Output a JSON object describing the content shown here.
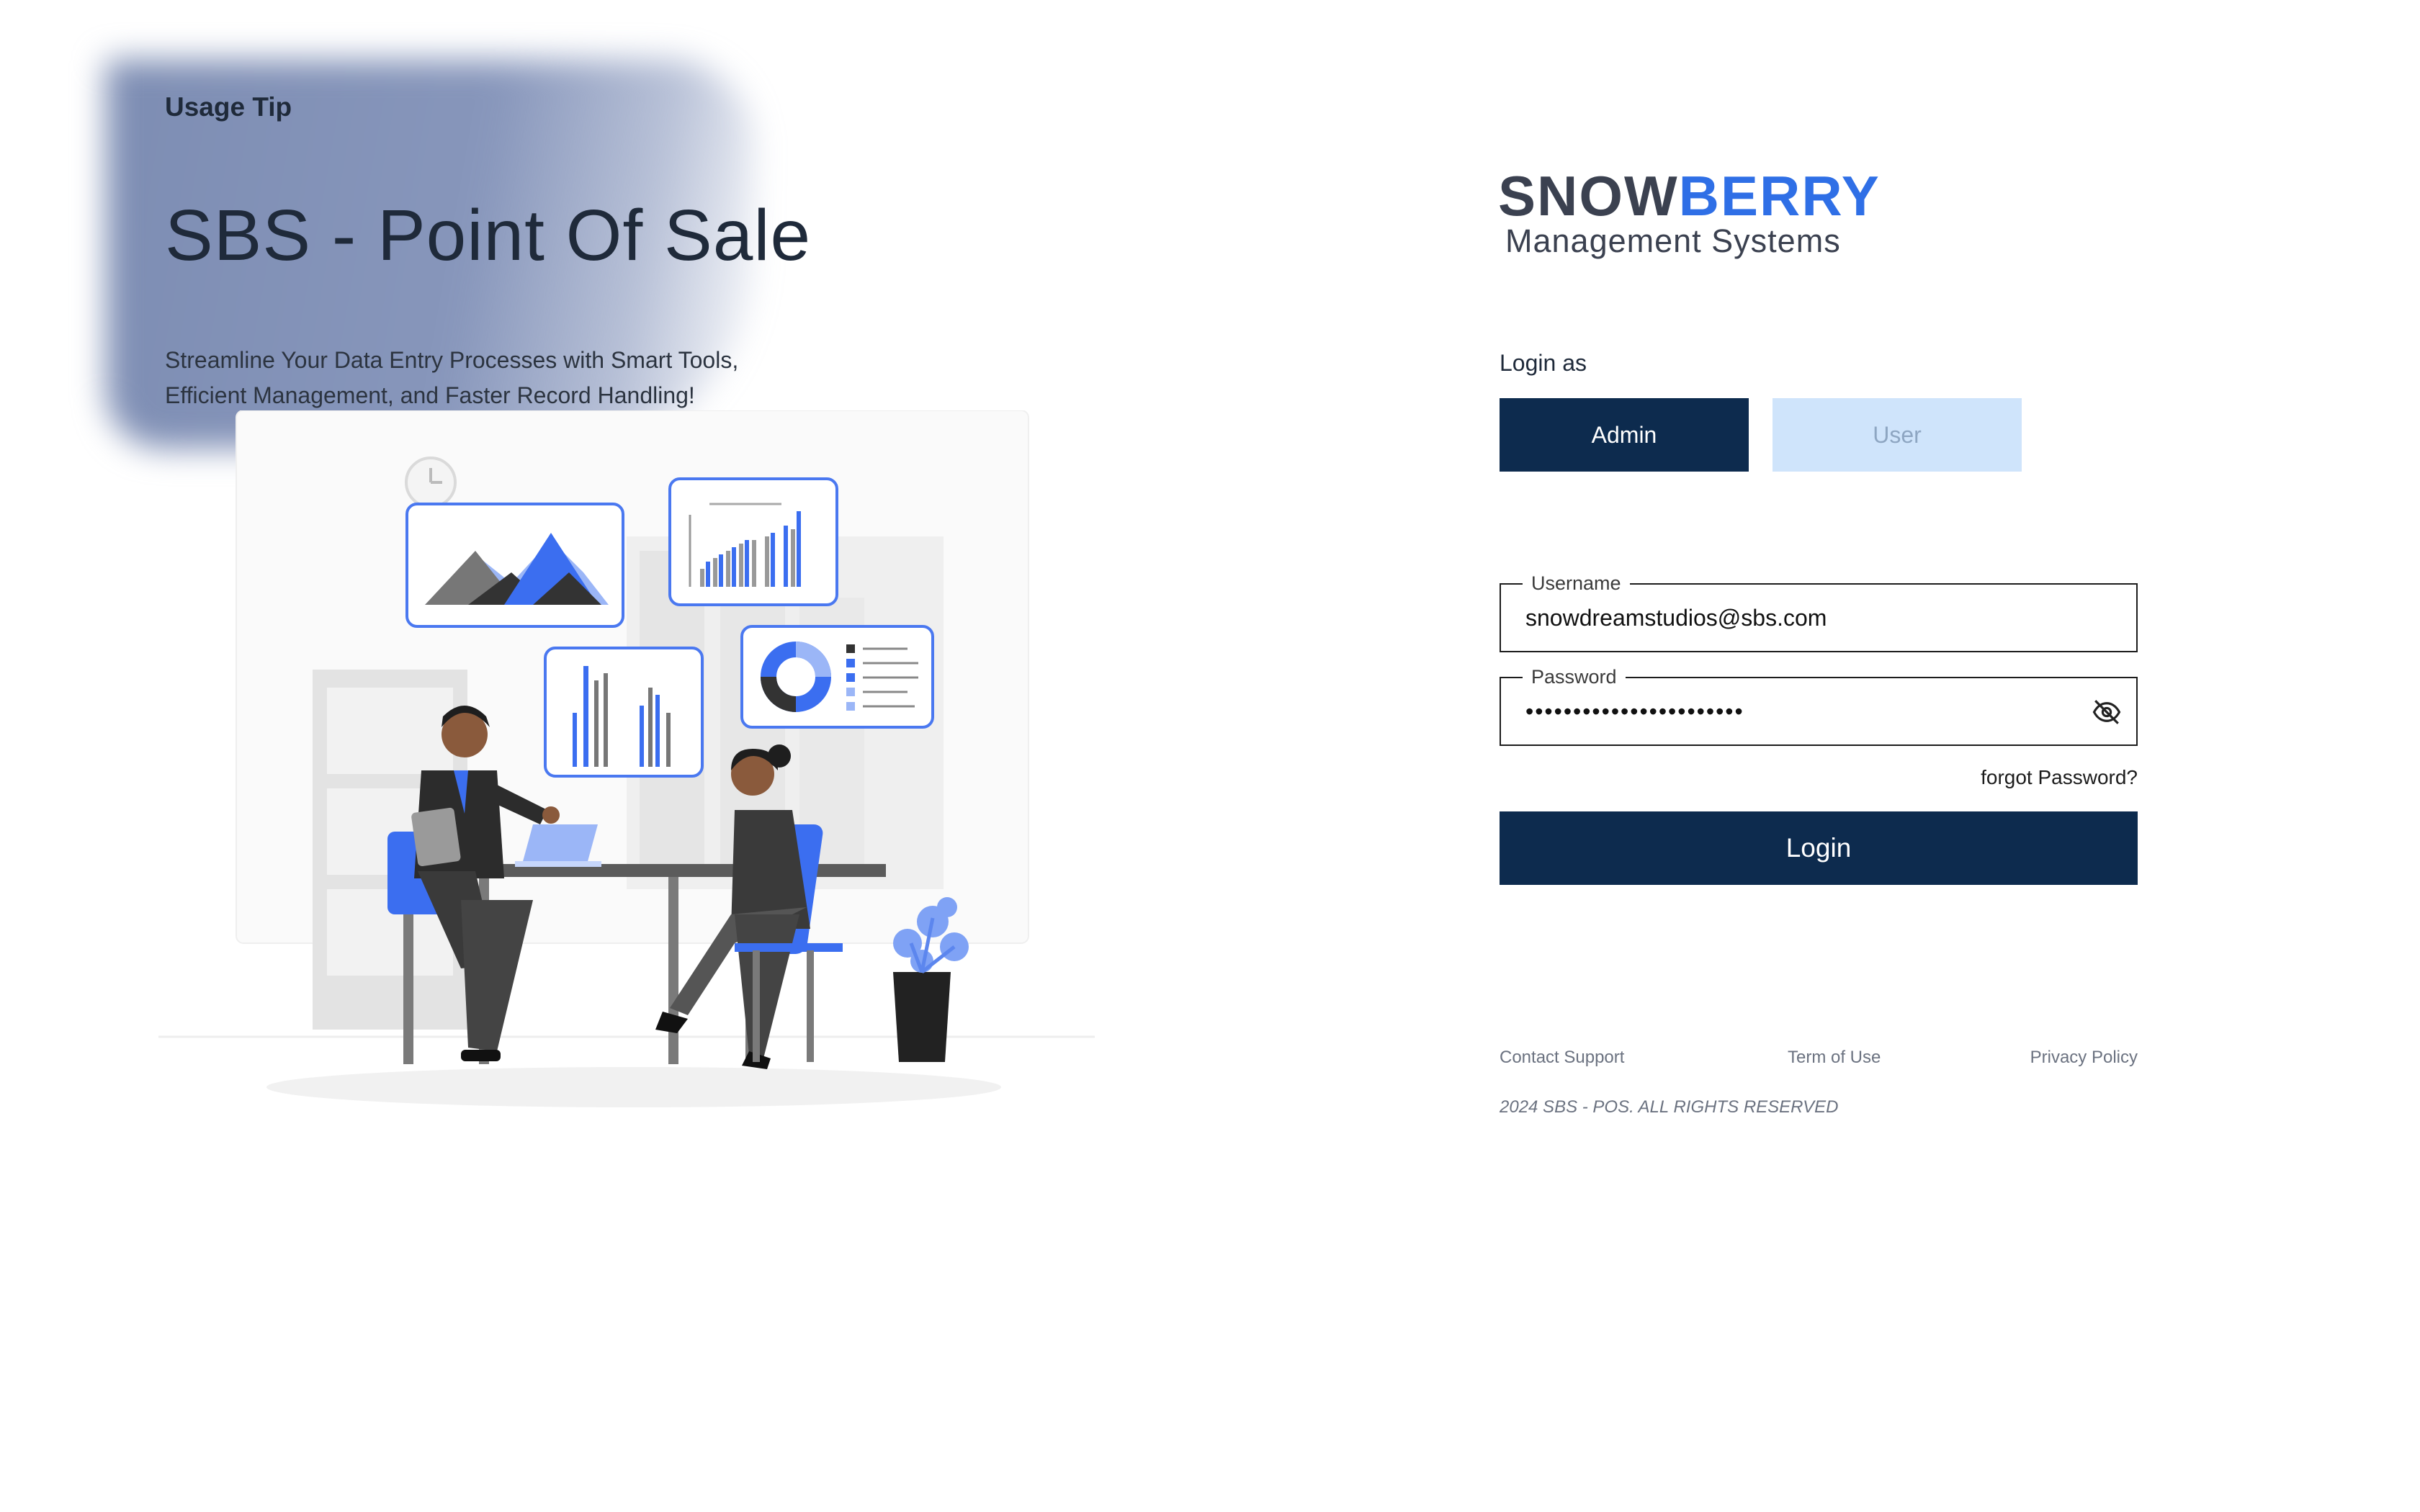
{
  "hero": {
    "usage_tip": "Usage Tip",
    "title": "SBS - Point Of Sale",
    "subtitle_line1": "Streamline Your Data Entry Processes with Smart Tools,",
    "subtitle_line2": "Efficient Management, and Faster Record Handling!"
  },
  "logo": {
    "main_part1": "SNOW",
    "main_part2": "BERRY",
    "sub": "Management Systems"
  },
  "login": {
    "login_as_label": "Login as",
    "roles": [
      "Admin",
      "User"
    ],
    "selected_role": "Admin",
    "username_label": "Username",
    "username_value": "snowdreamstudios@sbs.com",
    "password_label": "Password",
    "password_masked": "•••••••••••••••••••••••",
    "forgot_label": "forgot Password?",
    "submit_label": "Login"
  },
  "footer": {
    "contact": "Contact Support",
    "terms": "Term of Use",
    "privacy": "Privacy Policy",
    "copyright": "2024 SBS - POS. ALL RIGHTS RESERVED"
  },
  "colors": {
    "primary_navy": "#0d2b4e",
    "user_button_bg": "#cfe4fb",
    "brand_blue": "#2f6fe6",
    "hero_blob": "#8796bb"
  },
  "icons": {
    "password_toggle": "eye-off-icon"
  }
}
